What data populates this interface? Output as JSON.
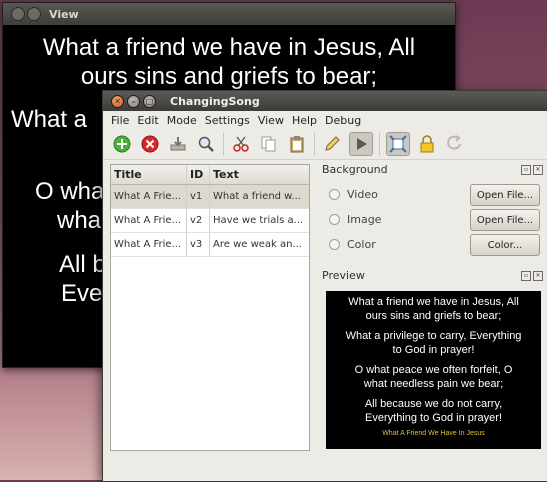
{
  "view_window": {
    "title": "View",
    "line1": "What a friend we have in Jesus, All",
    "line2": "ours sins and griefs to bear;",
    "line3": "What a",
    "line4": "O wha",
    "line5": "wha",
    "line6": "All b",
    "line7": "Eve"
  },
  "main_window": {
    "title": "ChangingSong",
    "menu": [
      "File",
      "Edit",
      "Mode",
      "Settings",
      "View",
      "Help",
      "Debug"
    ],
    "table": {
      "headers": [
        "Title",
        "ID",
        "Text"
      ],
      "rows": [
        [
          "What A Frie...",
          "v1",
          "What a friend w..."
        ],
        [
          "What A Frie...",
          "v2",
          "Have we trials a..."
        ],
        [
          "What A Frie...",
          "v3",
          "Are we weak an..."
        ]
      ]
    },
    "background": {
      "label": "Background",
      "options": [
        "Video",
        "Image",
        "Color"
      ],
      "buttons": [
        "Open File...",
        "Open File...",
        "Color..."
      ]
    },
    "preview": {
      "label": "Preview",
      "l1": "What a friend we have in Jesus, All",
      "l2": "ours sins and griefs to bear;",
      "l3": "What a privilege to carry, Everything",
      "l4": "to God in prayer!",
      "l5": "O what peace we often forfeit, O",
      "l6": "what needless pain we bear;",
      "l7": "All because we do not carry,",
      "l8": "Everything to God in prayer!",
      "footer": "What A Friend We Have In Jesus"
    },
    "colors": {
      "accent": "#d7581f",
      "selection": "#ded9cf",
      "footer_text": "#d9c23a"
    }
  }
}
